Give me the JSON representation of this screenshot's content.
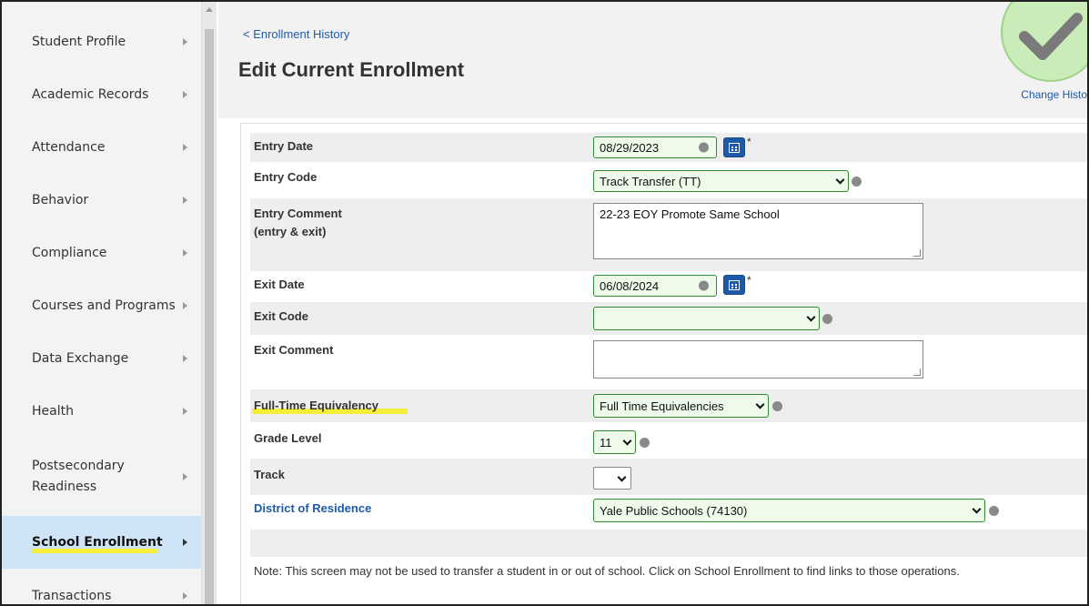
{
  "sidebar": {
    "items": [
      {
        "label": "Student Profile"
      },
      {
        "label": "Academic Records"
      },
      {
        "label": "Attendance"
      },
      {
        "label": "Behavior"
      },
      {
        "label": "Compliance"
      },
      {
        "label": "Courses and Programs"
      },
      {
        "label": "Data Exchange"
      },
      {
        "label": "Health"
      },
      {
        "label": "Postsecondary Readiness"
      },
      {
        "label": "School Enrollment"
      },
      {
        "label": "Transactions"
      }
    ],
    "active_item": "School Enrollment"
  },
  "header": {
    "back_link": "< Enrollment History",
    "title": "Edit Current Enrollment",
    "change_history": "Change Histo"
  },
  "form": {
    "entry_date": {
      "label": "Entry Date",
      "value": "08/29/2023"
    },
    "entry_code": {
      "label": "Entry Code",
      "value": "Track Transfer (TT)"
    },
    "entry_comment": {
      "label_line1": "Entry Comment",
      "label_line2": "(entry & exit)",
      "value": "22-23 EOY Promote Same School"
    },
    "exit_date": {
      "label": "Exit Date",
      "value": "06/08/2024"
    },
    "exit_code": {
      "label": "Exit Code",
      "value": ""
    },
    "exit_comment": {
      "label": "Exit Comment",
      "value": ""
    },
    "fte": {
      "label": "Full-Time Equivalency",
      "value": "Full Time Equivalencies"
    },
    "grade_level": {
      "label": "Grade Level",
      "value": "11"
    },
    "track": {
      "label": "Track",
      "value": ""
    },
    "district": {
      "label": "District of Residence",
      "value": "Yale Public Schools (74130)"
    },
    "required_marker": "*"
  },
  "note": "Note: This screen may not be used to transfer a student in or out of school. Click on School Enrollment to find links to those operations.",
  "colors": {
    "accent_link": "#1e5aa8",
    "valid_border": "#2e8b2e",
    "valid_fill": "#eefbea",
    "highlight": "#f6ef3a",
    "active_nav": "#cfe4f7"
  },
  "icons": {
    "check": "check-mark-icon",
    "calendar": "calendar-icon",
    "chevron": "chevron-right-icon",
    "valid": "valid-dot-icon"
  }
}
